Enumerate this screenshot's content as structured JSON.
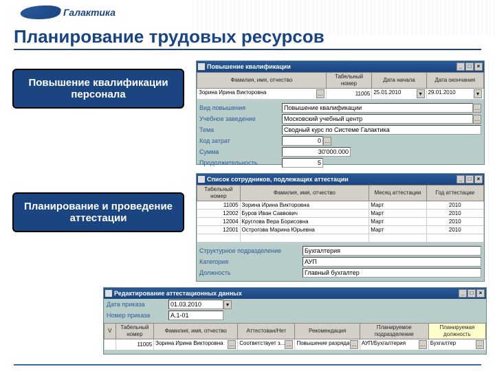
{
  "logo": "Галактика",
  "title": "Планирование трудовых ресурсов",
  "callouts": {
    "c1": "Повышение квалификации персонала",
    "c2": "Планирование и проведение аттестации"
  },
  "win1": {
    "title": "Повышение квалификации",
    "h": {
      "fio": "Фамилия, имя, отчество",
      "tab": "Табельный номер",
      "d1": "Дата начала",
      "d2": "Дата окончания"
    },
    "r": {
      "fio": "Зорина Ирина Викторовна",
      "tab": "11005",
      "d1": "25.01.2010",
      "d2": "29.01.2010"
    },
    "labels": {
      "vid": "Вид повышения",
      "uch": "Учебное заведение",
      "tema": "Тема",
      "kod": "Код затрат",
      "sum": "Сумма",
      "prod": "Продолжительность"
    },
    "vals": {
      "vid": "Повышение квалификации",
      "uch": "Московский учебный центр",
      "tema": "Сводный курс по Системе Галактика",
      "kod": "0",
      "sum": "30'000.000",
      "prod": "5"
    }
  },
  "win2": {
    "title": "Список сотрудников, подлежащих аттестации",
    "h": {
      "tab": "Табельный номер",
      "fio": "Фамилия, имя, отчество",
      "mes": "Месяц аттестации",
      "god": "Год аттестации"
    },
    "rows": [
      {
        "tab": "11005",
        "fio": "Зорина Ирина Викторовна",
        "mes": "Март",
        "god": "2010"
      },
      {
        "tab": "12002",
        "fio": "Буров Иван Саввович",
        "mes": "Март",
        "god": "2010"
      },
      {
        "tab": "12004",
        "fio": "Круглова Вера Борисовна",
        "mes": "Март",
        "god": "2010"
      },
      {
        "tab": "12001",
        "fio": "Острогова Марина Юрьевна",
        "mes": "Март",
        "god": "2010"
      }
    ],
    "labels": {
      "struk": "Структурное подразделение",
      "kat": "Категория",
      "dolzh": "Должность"
    },
    "vals": {
      "struk": "Бухгалтерия",
      "kat": "АУП",
      "dolzh": "Главный бухгалтер"
    }
  },
  "win3": {
    "title": "Редактирование аттестационных данных",
    "labels": {
      "dprik": "Дата приказа",
      "nprik": "Номер приказа"
    },
    "vals": {
      "dprik": "01.03.2010",
      "nprik": "А.1-01"
    },
    "h": {
      "v": "V",
      "tab": "Табельный номер",
      "fio": "Фамилия, имя, отчество",
      "res": "Аттестован/Нет",
      "rec": "Рекомендация",
      "plan": "Планируемое подразделение",
      "pld": "Планируемая должность"
    },
    "r": {
      "v": "",
      "tab": "11005",
      "fio": "Зорина Ирина Викторовна",
      "res": "Соответствует з...",
      "rec": "Повышение разряда",
      "plan": "АУП/Бухгалтерия",
      "pld": "Бухгалтер"
    }
  }
}
